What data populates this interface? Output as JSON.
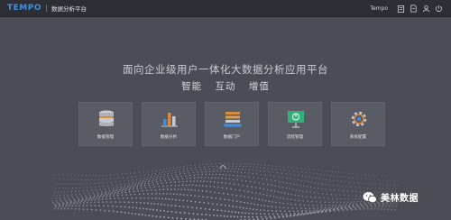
{
  "header": {
    "logo_text": "TEMPO",
    "title": "数据分析平台",
    "user": "Tempo",
    "icons": [
      "clipboard-icon",
      "document-icon",
      "user-icon",
      "power-icon"
    ]
  },
  "main": {
    "slogan": "面向企业级用户一体化大数据分析应用平台",
    "subslogan": "智能 互动 增值",
    "cards": [
      {
        "label": "数据管理",
        "icon": "database-icon"
      },
      {
        "label": "数据分析",
        "icon": "bar-chart-icon"
      },
      {
        "label": "数据门户",
        "icon": "portal-icon"
      },
      {
        "label": "流程管理",
        "icon": "presentation-icon"
      },
      {
        "label": "系统配置",
        "icon": "gear-icon"
      }
    ]
  },
  "watermark": {
    "text": "美林数据"
  },
  "colors": {
    "background": "#4b4d56",
    "topbar": "#2d2f35",
    "accent_blue": "#3f8fe0",
    "accent_green": "#2fb37a",
    "accent_orange": "#d98d3c"
  }
}
